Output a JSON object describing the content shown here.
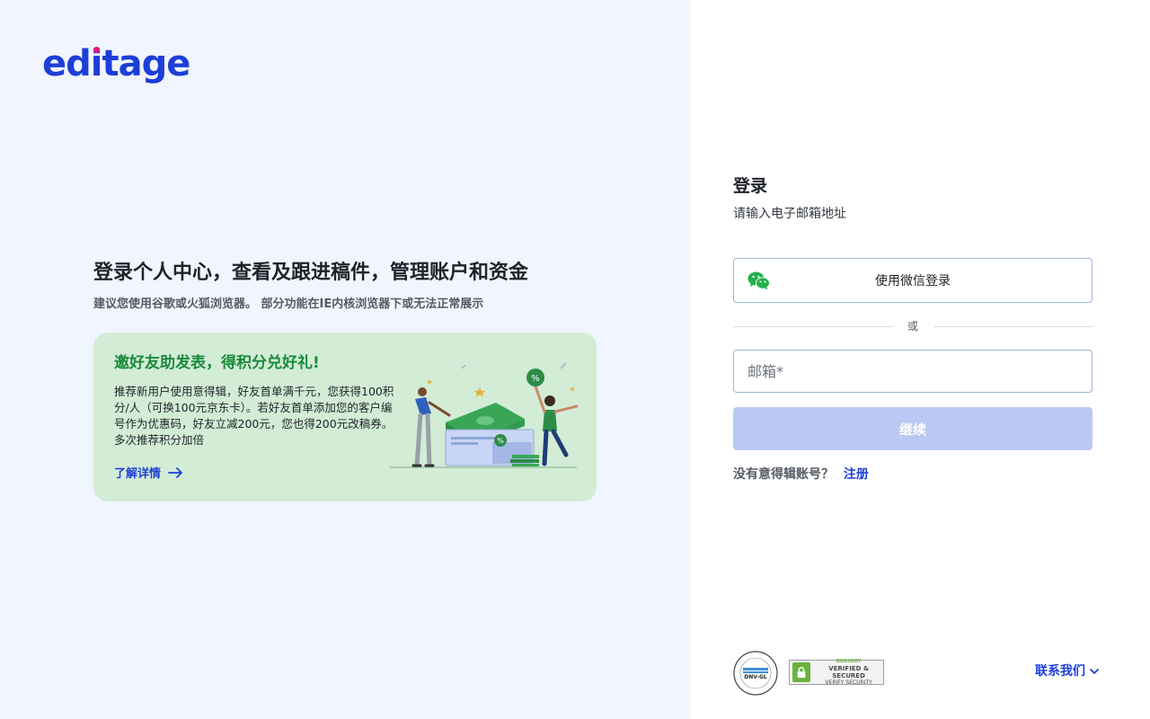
{
  "brand": {
    "logo_text_before": "ed",
    "logo_text_i": "i",
    "logo_text_after": "tage",
    "primary_color": "#1d3fd8",
    "accent_dot_color": "#e8177e"
  },
  "hero": {
    "title": "登录个人中心，查看及跟进稿件，管理账户和资金",
    "subtitle": "建议您使用谷歌或火狐浏览器。 部分功能在IE内核浏览器下或无法正常展示"
  },
  "promo": {
    "title": "邀好友助发表，得积分兑好礼!",
    "body": "推荐新用户使用意得辑，好友首单满千元，您获得100积分/人（可换100元京东卡）。若好友首单添加您的客户编号作为优惠码，好友立减200元，您也得200元改稿券。多次推荐积分加倍",
    "link_label": "了解详情",
    "background_color": "#d2ecd6",
    "title_color": "#1a8a3a"
  },
  "login": {
    "title": "登录",
    "subtitle": "请输入电子邮箱地址",
    "wechat_button_label": "使用微信登录",
    "divider_text": "或",
    "email_placeholder": "邮箱*",
    "email_value": "",
    "continue_label": "继续",
    "continue_disabled_color": "#b9c9f3",
    "signup_question": "没有意得辑账号？",
    "signup_link": "注册"
  },
  "footer": {
    "badge_dnv_label": "DNV-GL",
    "badge_godaddy_top": "GODADDY",
    "badge_godaddy_mid": "VERIFIED & SECURED",
    "badge_godaddy_bot": "VERIFY SECURITY",
    "contact_label": "联系我们"
  }
}
